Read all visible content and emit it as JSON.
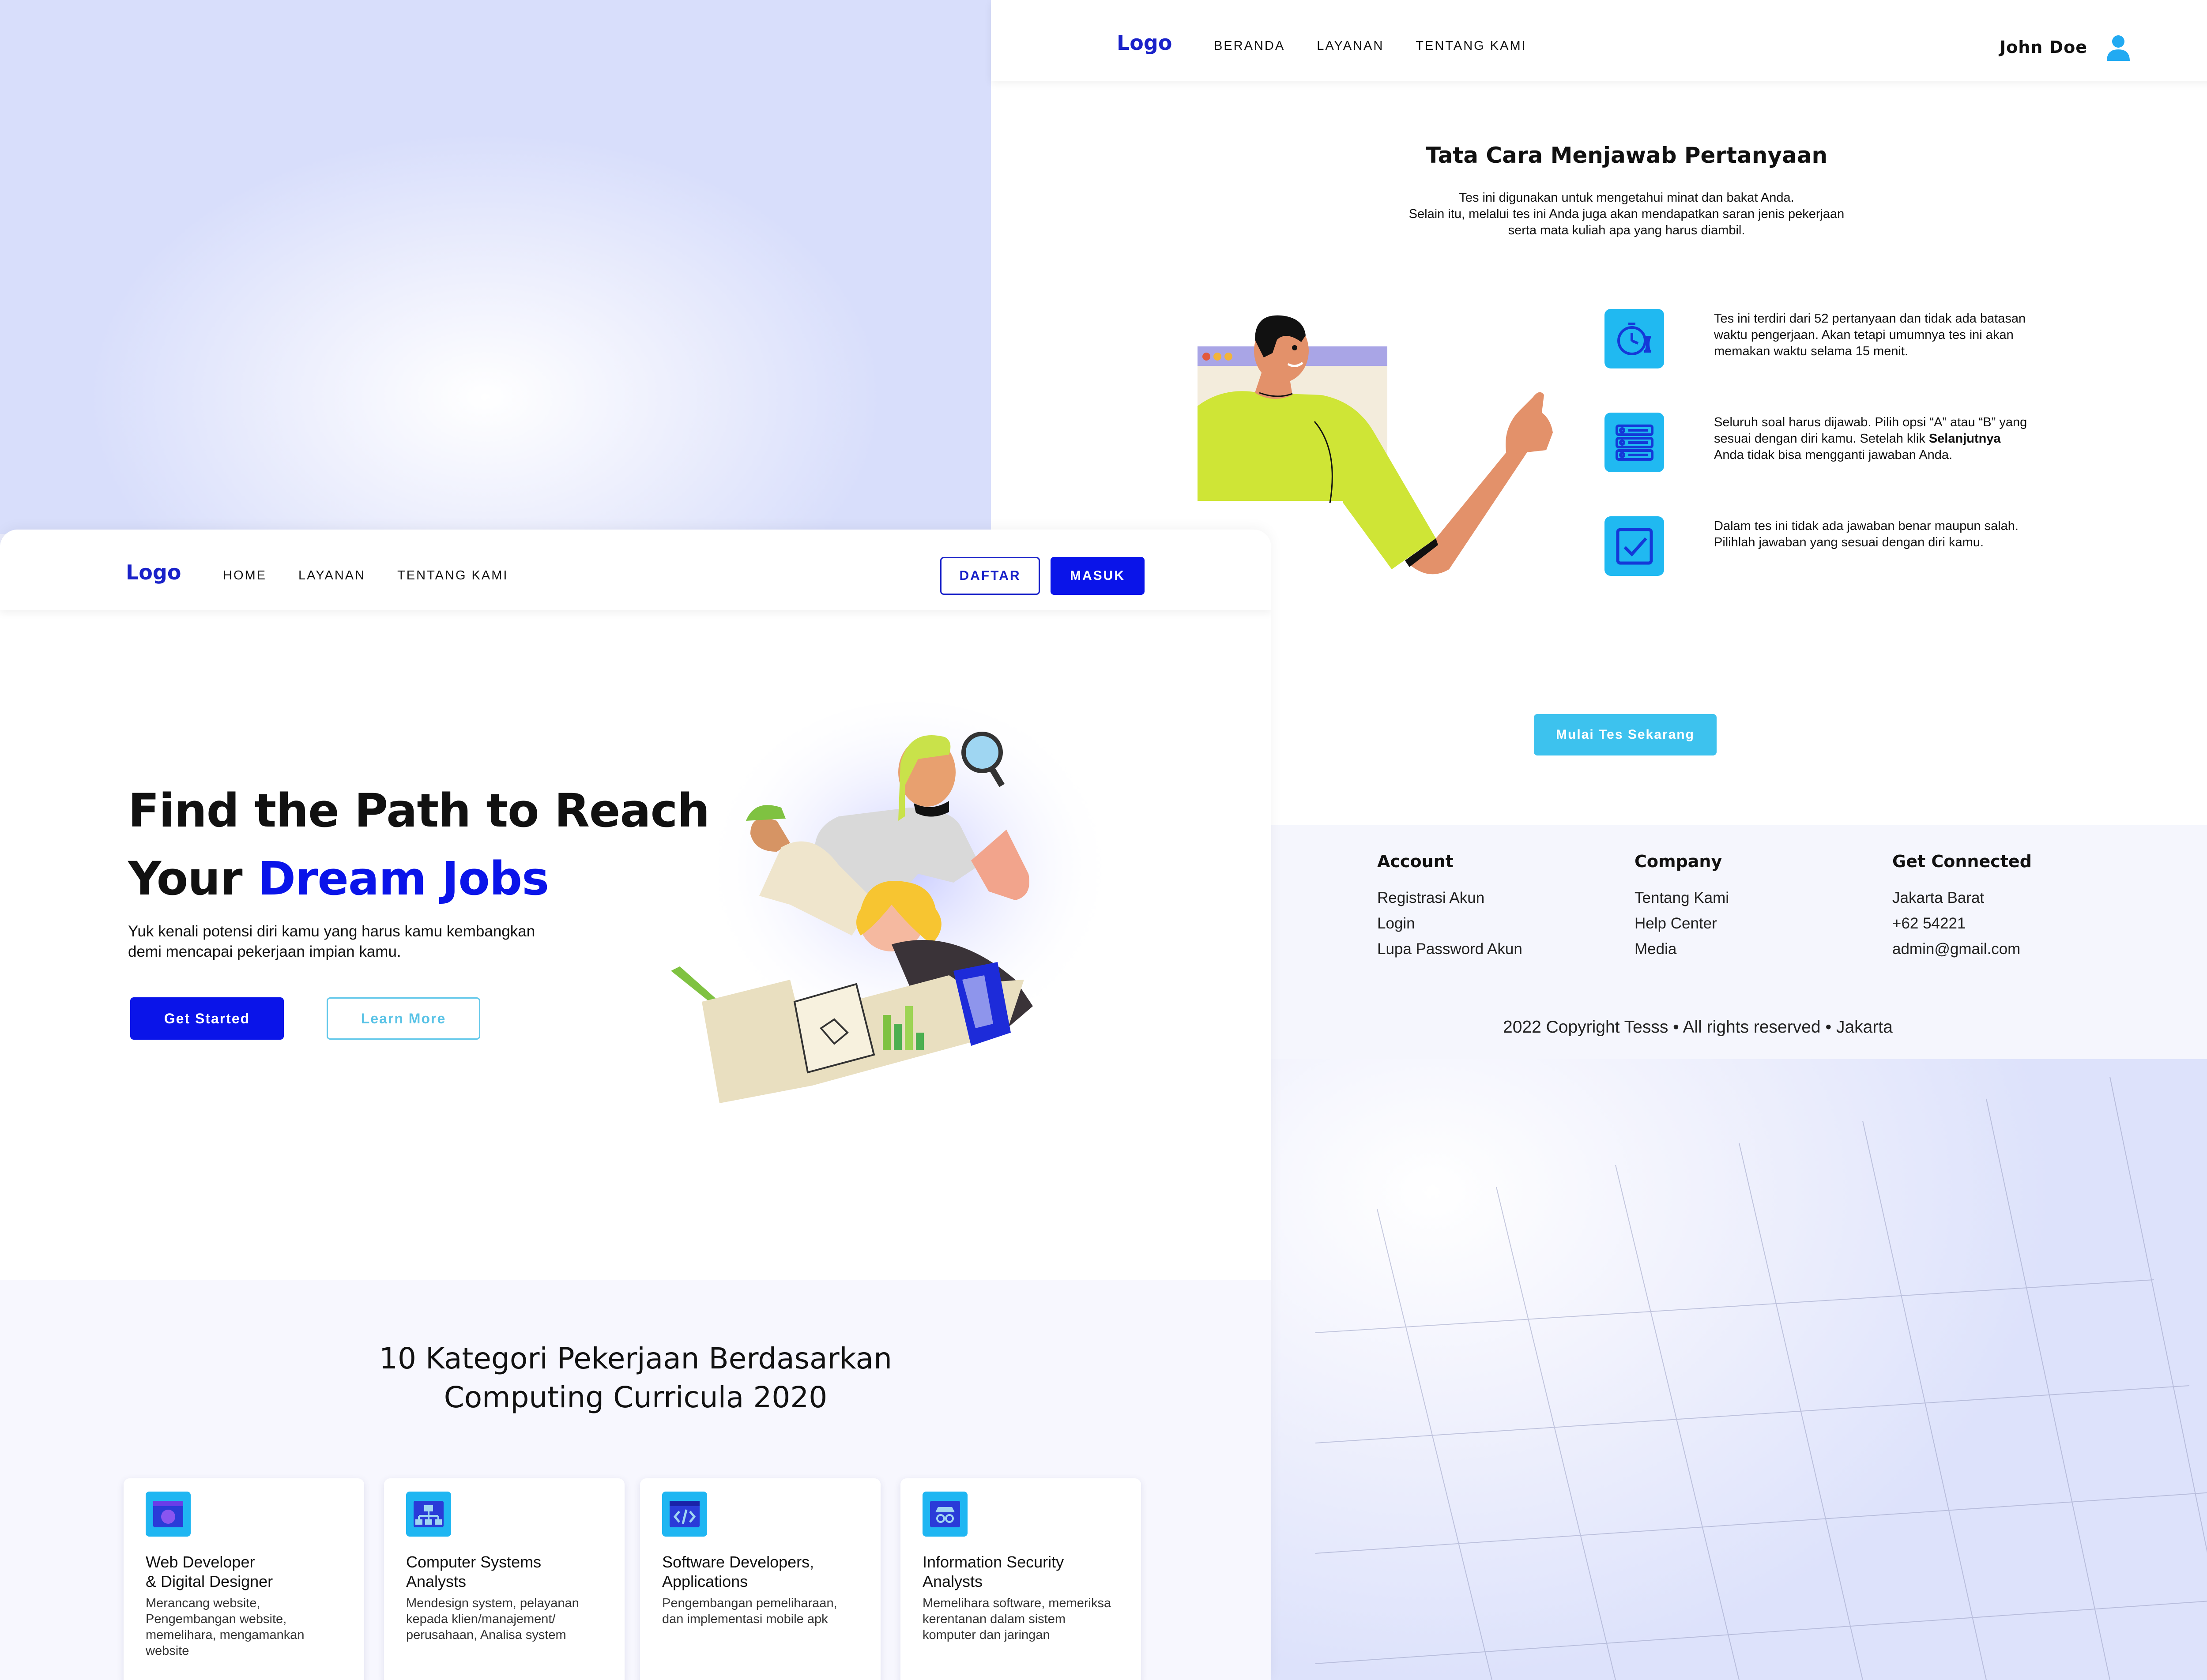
{
  "quiz_page": {
    "nav": {
      "logo": "Logo",
      "menu": [
        "BERANDA",
        "LAYANAN",
        "TENTANG KAMI"
      ],
      "user_name": "John Doe",
      "user_icon": "user-icon"
    },
    "title": "Tata Cara Menjawab Pertanyaan",
    "intro": [
      "Tes ini digunakan untuk mengetahui minat dan bakat Anda.",
      "Selain itu, melalui tes ini Anda juga akan mendapatkan saran jenis pekerjaan",
      "serta mata kuliah apa yang harus diambil."
    ],
    "steps": [
      {
        "icon": "timer-icon",
        "text": "Tes ini terdiri dari 52 pertanyaan dan tidak ada batasan waktu pengerjaan. Akan tetapi umumnya tes ini akan memakan waktu selama 15 menit."
      },
      {
        "icon": "checklist-icon",
        "text_before": "Seluruh soal harus dijawab. Pilih opsi “A” atau “B” yang sesuai dengan diri kamu. Setelah klik ",
        "text_bold": "Selanjutnya",
        "text_after": " Anda tidak bisa mengganti jawaban Anda."
      },
      {
        "icon": "checkbox-icon",
        "text": "Dalam tes ini tidak ada jawaban benar maupun salah. Pilihlah jawaban yang sesuai dengan diri kamu."
      }
    ],
    "cta_label": "Mulai Tes Sekarang",
    "footer": {
      "columns": [
        {
          "heading": "Account",
          "items": [
            "Registrasi Akun",
            "Login",
            "Lupa Password Akun"
          ]
        },
        {
          "heading": "Company",
          "items": [
            "Tentang Kami",
            "Help Center",
            "Media"
          ]
        },
        {
          "heading": "Get Connected",
          "items": [
            "Jakarta Barat",
            "+62 54221",
            "admin@gmail.com"
          ]
        }
      ],
      "copyright": "2022 Copyright Tesss • All rights reserved • Jakarta"
    }
  },
  "landing_page": {
    "nav": {
      "logo": "Logo",
      "menu": [
        "HOME",
        "LAYANAN",
        "TENTANG KAMI"
      ],
      "register_label": "DAFTAR",
      "login_label": "MASUK"
    },
    "hero": {
      "title_line1": "Find the Path to Reach",
      "title_line2_prefix": "Your ",
      "title_line2_accent": "Dream Jobs",
      "subtitle": [
        "Yuk kenali potensi diri kamu yang harus kamu kembangkan",
        "demi mencapai pekerjaan impian kamu."
      ],
      "primary_button": "Get Started",
      "secondary_button": "Learn More",
      "accent_color": "#0a14e9"
    },
    "categories": {
      "title": [
        "10 Kategori Pekerjaan Berdasarkan",
        "Computing Curricula 2020"
      ],
      "cards": [
        {
          "icon": "web-icon",
          "name": [
            "Web Developer",
            "& Digital Designer"
          ],
          "desc": [
            "Merancang website,",
            "Pengembangan website,",
            "memelihara, mengamankan",
            "website"
          ]
        },
        {
          "icon": "network-icon",
          "name": [
            "Computer Systems",
            "Analysts"
          ],
          "desc": [
            "Mendesign system, pelayanan",
            "kepada klien/manajement/",
            "perusahaan, Analisa system"
          ]
        },
        {
          "icon": "code-icon",
          "name": [
            "Software Developers,",
            "Applications"
          ],
          "desc": [
            "Pengembangan pemeliharaan,",
            "dan implementasi mobile apk"
          ]
        },
        {
          "icon": "security-icon",
          "name": [
            "Information Security",
            "Analysts"
          ],
          "desc": [
            "Memelihara software, memeriksa",
            "kerentanan dalam sistem",
            "komputer dan jaringan"
          ]
        }
      ]
    }
  }
}
